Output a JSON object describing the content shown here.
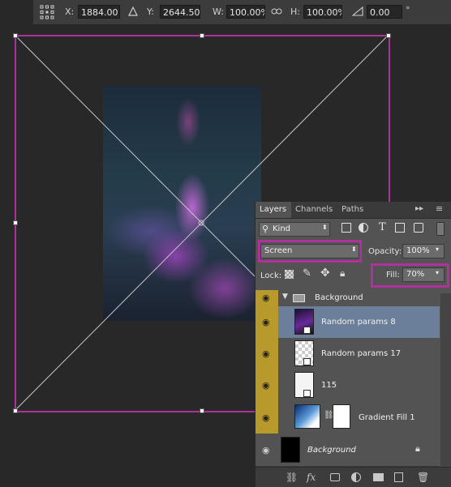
{
  "options_bar": {
    "x_label": "X:",
    "x_value": "1884.00 px",
    "y_label": "Y:",
    "y_value": "2644.50 px",
    "w_label": "W:",
    "w_value": "100.00%",
    "h_label": "H:",
    "h_value": "100.00%",
    "angle_value": "0.00",
    "degree_symbol": "°"
  },
  "layers_panel": {
    "tabs": [
      "Layers",
      "Channels",
      "Paths"
    ],
    "filter_kind": "Kind",
    "blend_mode": "Screen",
    "opacity_label": "Opacity:",
    "opacity_value": "100%",
    "lock_label": "Lock:",
    "fill_label": "Fill:",
    "fill_value": "70%",
    "layers": [
      {
        "name": "Background",
        "kind": "group"
      },
      {
        "name": "Random params 8",
        "kind": "layer",
        "selected": true
      },
      {
        "name": "Random params 17",
        "kind": "layer"
      },
      {
        "name": "115",
        "kind": "layer"
      },
      {
        "name": "Gradient Fill 1",
        "kind": "fill"
      },
      {
        "name": "Background",
        "kind": "background"
      }
    ]
  },
  "colors": {
    "selection_highlight": "#b0319c",
    "eye_column": "#b89a2c",
    "selected_row": "#6b7f9b"
  }
}
